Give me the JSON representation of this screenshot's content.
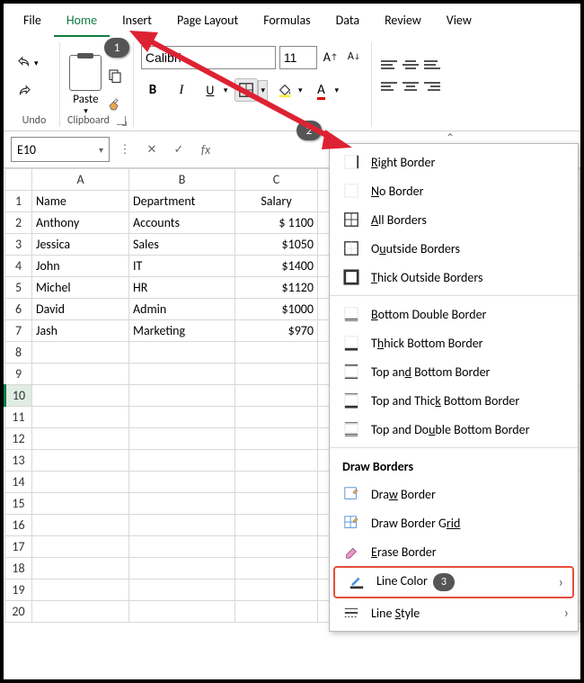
{
  "menu": {
    "file": "File",
    "home": "Home",
    "insert": "Insert",
    "page_layout": "Page Layout",
    "formulas": "Formulas",
    "data": "Data",
    "review": "Review",
    "view": "View"
  },
  "ribbon": {
    "undo_label": "Undo",
    "clipboard_label": "Clipboard",
    "paste": "Paste",
    "font_name": "Calibri",
    "font_size": "11"
  },
  "name_box": "E10",
  "columns": [
    "A",
    "B",
    "C"
  ],
  "rows": [
    {
      "n": "1",
      "a": "Name",
      "b": "Department",
      "c": "Salary"
    },
    {
      "n": "2",
      "a": "Anthony",
      "b": "Accounts",
      "c": "$ 1100"
    },
    {
      "n": "3",
      "a": "Jessica",
      "b": "Sales",
      "c": "$1050"
    },
    {
      "n": "4",
      "a": "John",
      "b": "IT",
      "c": "$1400"
    },
    {
      "n": "5",
      "a": "Michel",
      "b": "HR",
      "c": "$1120"
    },
    {
      "n": "6",
      "a": "David",
      "b": "Admin",
      "c": "$1000"
    },
    {
      "n": "7",
      "a": "Jash",
      "b": "Marketing",
      "c": "$970"
    }
  ],
  "blank_rows": [
    "8",
    "9",
    "10",
    "11",
    "12",
    "13",
    "14",
    "15",
    "16",
    "17",
    "18",
    "19",
    "20"
  ],
  "dropdown": {
    "right_border": "ight Border",
    "no_border": "o Border",
    "all_borders": "ll Borders",
    "outside_borders": "utside Borders",
    "thick_outside": "hick Outside Borders",
    "bottom_double": "ottom Double Border",
    "thick_bottom": "hick Bottom Border",
    "top_bottom": "Top an",
    "top_bottom2": " Bottom Border",
    "top_thick": "Top and Thic",
    "top_thick2": " Bottom Border",
    "top_double": "Top and Do",
    "top_double2": "ble Bottom Border",
    "draw_header": "Draw Borders",
    "draw_border": "Dra",
    "draw_border2": " Border",
    "draw_grid": "Draw Border ",
    "draw_grid2": "rid",
    "erase": "rase Border",
    "line_color": "Line Color",
    "line_style": "Line ",
    "line_style2": "tyle"
  },
  "callouts": {
    "c1": "1",
    "c2": "2",
    "c3": "3"
  }
}
